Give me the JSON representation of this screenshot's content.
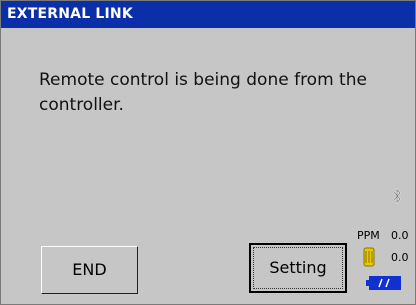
{
  "window": {
    "title": "EXTERNAL LINK"
  },
  "message": {
    "text": "Remote control is being done from the controller."
  },
  "buttons": {
    "end_label": "END",
    "setting_label": "Setting"
  },
  "status": {
    "bluetooth_icon": "bluetooth-icon",
    "ppm_label": "PPM",
    "ppm_value": "0.0",
    "sensor_icon": "sensor-icon",
    "sensor_value": "0.0",
    "battery_icon": "battery-icon"
  },
  "colors": {
    "title_bar": "#0a2fa8",
    "background": "#c6c6c6",
    "battery_fill": "#1030d0",
    "sensor": "#e8c800"
  }
}
